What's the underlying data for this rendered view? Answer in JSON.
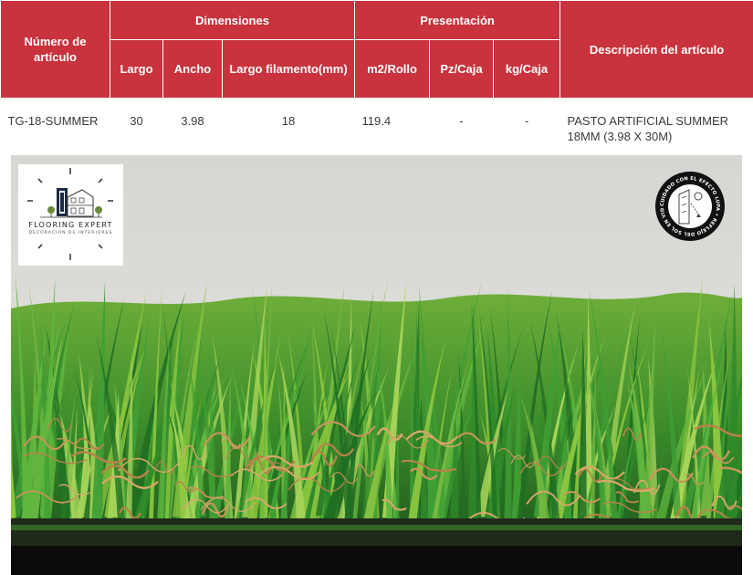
{
  "table": {
    "headers": {
      "article_number": "Número de artículo",
      "dimensions": "Dimensiones",
      "presentation": "Presentación",
      "description": "Descripción del artículo",
      "length": "Largo",
      "width": "Ancho",
      "filament_length": "Largo filamento(mm)",
      "m2_roll": "m2/Rollo",
      "pz_box": "Pz/Caja",
      "kg_box": "kg/Caja"
    },
    "row": {
      "article_number": "TG-18-SUMMER",
      "length": "30",
      "width": "3.98",
      "filament_length": "18",
      "m2_roll": "119.4",
      "pz_box": "-",
      "kg_box": "-",
      "description": "PASTO ARTIFICIAL SUMMER 18MM (3.98 X 30M)"
    }
  },
  "logo": {
    "title": "FLOORING EXPERT",
    "subtitle": "DECORACIÓN DE INTERIORES"
  },
  "badge": {
    "ring_text": "CUIDADO CON EL EFECTO LUPA • REFLEJO DEL SOL EN VIDRIOS DECORATIVOS •"
  },
  "colors": {
    "header_bg": "#c8333d",
    "grass_dark": "#2f8a2a",
    "grass_light": "#8cc63f",
    "thatch": "#c9955a"
  }
}
